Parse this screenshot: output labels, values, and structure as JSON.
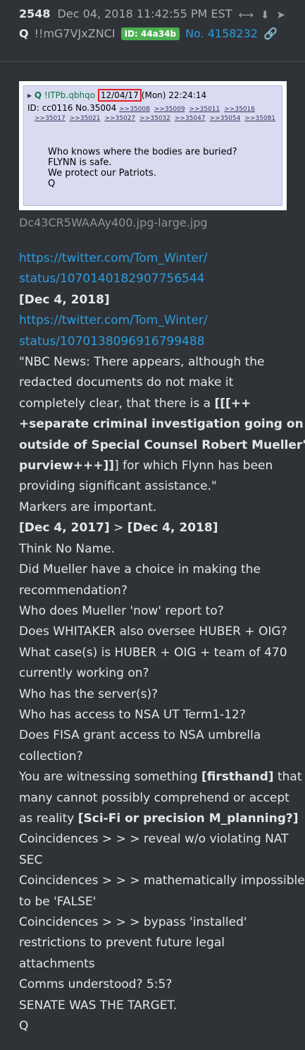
{
  "post": {
    "number": "2548",
    "date": "Dec 04, 2018 11:42:55 PM EST",
    "author": "Q",
    "tripcode": "!!mG7VJxZNCI",
    "id_badge": "ID: 44a34b",
    "post_no": "No. 4158232",
    "icons": [
      "share-icon",
      "download-icon",
      "goto-icon",
      "link-icon"
    ]
  },
  "image": {
    "q_name": "Q",
    "trip": "!ITPb.qbhqo",
    "date": "12/04/17",
    "time": "(Mon) 22:24:14",
    "id_line": "ID: cc0116 No.35004",
    "replies_row1": [
      ">>35008",
      ">>35009",
      ">>35011",
      ">>35016"
    ],
    "replies_row2": [
      ">>35017",
      ">>35021",
      ">>35027",
      ">>35032",
      ">>35047",
      ">>35054",
      ">>35081"
    ],
    "message": [
      "Who knows where the bodies are buried?",
      "FLYNN is safe.",
      "We protect our Patriots.",
      "Q"
    ],
    "filename": "Dc43CR5WAAAy400.jpg-large.jpg"
  },
  "body": {
    "link1a": "https://twitter.com/Tom_Winter/",
    "link1b": "status/1070140182907756544",
    "date1": "[Dec 4, 2018]",
    "link2a": "https://twitter.com/Tom_Winter/",
    "link2b": "status/1070138096916799488",
    "nbc1": "\"NBC News: There appears, although the",
    "nbc2": "redacted documents do not make it",
    "nbc3a": "completely clear, that there is a ",
    "nbc3b": "[[[++",
    "nbc4": "+separate criminal investigation going on",
    "nbc5": "outside of Special Counsel Robert Mueller's",
    "nbc6a": "purview+++]]",
    "nbc6b": "] for which Flynn has been",
    "nbc7": "providing significant assistance.\"",
    "markers": "Markers are important.",
    "dates_a": "[Dec 4, 2017]",
    "dates_sep": " > ",
    "dates_b": "[Dec 4, 2018]",
    "think": "Think No Name.",
    "mueller1": "Did Mueller have a choice in making the",
    "mueller2": "recommendation?",
    "report": "Who does Mueller 'now' report to?",
    "whitaker": "Does WHITAKER also oversee HUBER + OIG?",
    "case1": "What case(s) is HUBER + OIG + team of 470",
    "case2": "currently working on?",
    "server": "Who has the server(s)?",
    "nsa": "Who has access to NSA UT Term1-12?",
    "fisa1": "Does FISA grant access to NSA umbrella",
    "fisa2": "collection?",
    "wit1a": "You are witnessing something ",
    "wit1b": "[firsthand]",
    "wit1c": " that",
    "wit2": "many cannot possibly comprehend or accept",
    "wit3a": "as reality ",
    "wit3b": "[Sci-Fi or precision M_planning?]",
    "coin1a": "Coincidences > > > reveal w/o violating NAT",
    "coin1b": "SEC",
    "coin2a": "Coincidences > > > mathematically impossible",
    "coin2b": "to be 'FALSE'",
    "coin3a": "Coincidences > > > bypass 'installed'",
    "coin3b": "restrictions to prevent future legal",
    "coin3c": "attachments",
    "comms": "Comms understood? 5:5?",
    "senate": "SENATE WAS THE TARGET.",
    "sig": "Q"
  }
}
